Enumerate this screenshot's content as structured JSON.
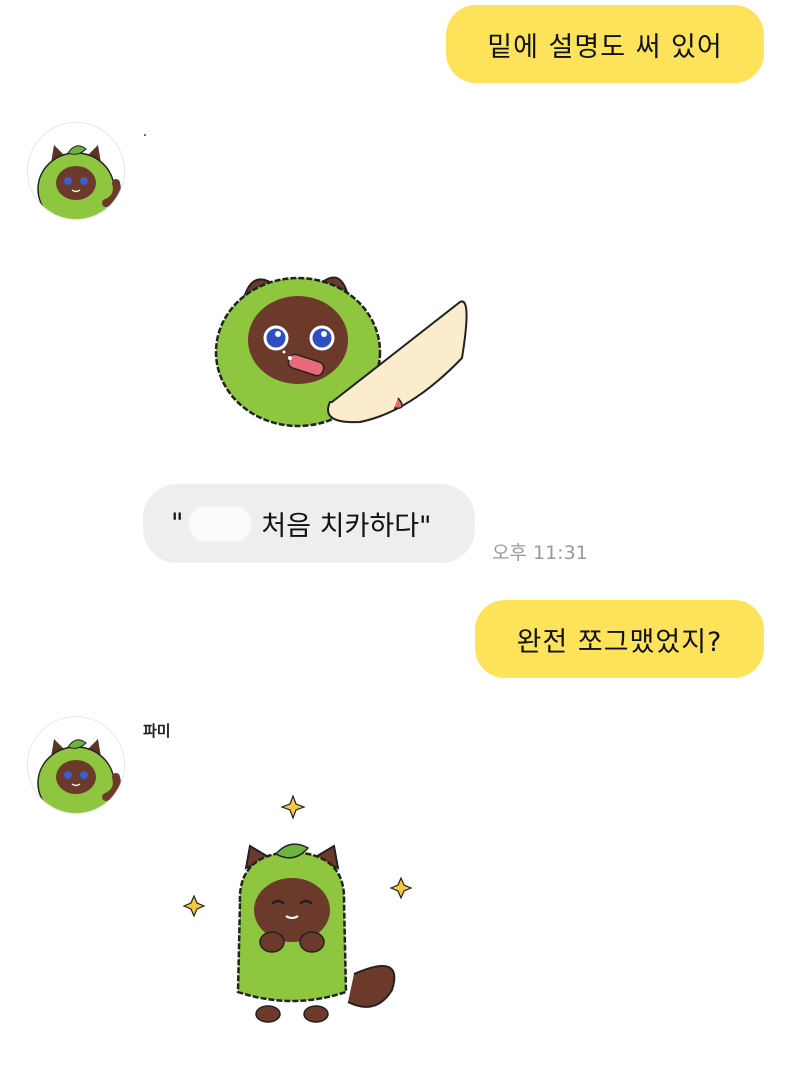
{
  "messages": {
    "out1": "밑에 설명도 써 있어",
    "sender1_name": "",
    "sender1_dot": ".",
    "in1_open_quote": "\"",
    "in1_text": "처음 치카하다\"",
    "in1_time": "오후 11:31",
    "out2": "완전 쪼그맸었지?",
    "sender2_name": "파미"
  },
  "colors": {
    "outgoing_bubble": "#fde35a",
    "incoming_bubble": "#eceeef",
    "sticker_green": "#8ec63f",
    "sticker_brown": "#6b3a2a"
  },
  "icons": {
    "avatar": "green-raccoon-cat-avatar",
    "sticker1": "raccoon-brushing-teeth-sticker",
    "sticker2": "raccoon-happy-sparkles-sticker"
  }
}
